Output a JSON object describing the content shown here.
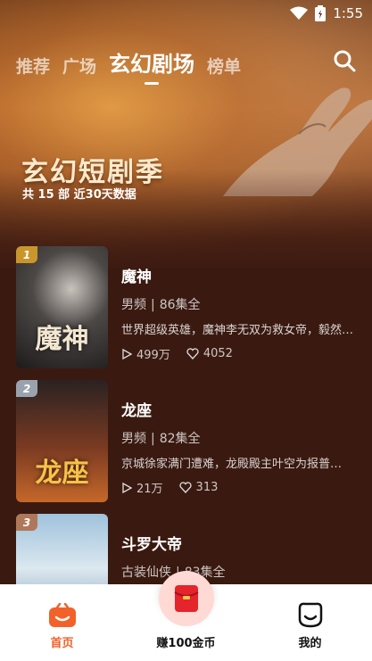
{
  "status": {
    "time": "1:55"
  },
  "tabs": [
    {
      "label": "推荐"
    },
    {
      "label": "广场"
    },
    {
      "label": "玄幻剧场"
    },
    {
      "label": "榜单"
    }
  ],
  "hero": {
    "title": "玄幻短剧季",
    "subtitle": "共 15 部  近30天数据"
  },
  "items": [
    {
      "rank": "1",
      "cover_title": "魔神",
      "title": "魔神",
      "genre": "男频",
      "episodes": "86集全",
      "desc": "世界超级英雄，魔神李无双为救女帝，毅然…",
      "plays": "499万",
      "likes": "4052",
      "rank_color": "#c9962c"
    },
    {
      "rank": "2",
      "cover_title": "龙座",
      "title": "龙座",
      "genre": "男频",
      "episodes": "82集全",
      "desc": "京城徐家满门遭难，龙殿殿主叶空为报普…",
      "plays": "21万",
      "likes": "313",
      "rank_color": "#9aa3ad"
    },
    {
      "rank": "3",
      "cover_title": "",
      "title": "斗罗大帝",
      "genre": "古装仙侠",
      "episodes": "83集全",
      "desc": "",
      "plays": "",
      "likes": "",
      "rank_color": "#b0785a"
    }
  ],
  "nav": {
    "home": "首页",
    "earn": "赚100金币",
    "mine": "我的"
  },
  "colors": {
    "accent": "#f2612a",
    "background": "#3e1b12"
  }
}
